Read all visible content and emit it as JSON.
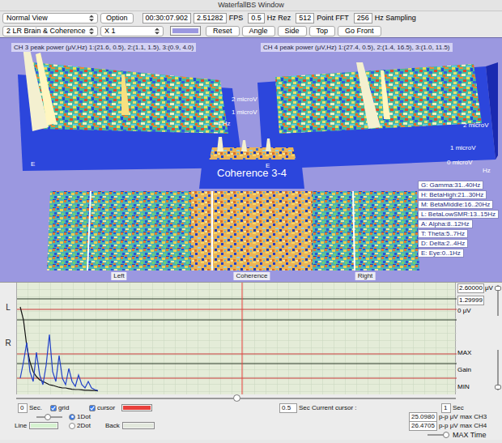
{
  "window": {
    "title": "WaterfallBS Window"
  },
  "toolbar": {
    "view_mode": {
      "value": "Normal View"
    },
    "option_button": "Option",
    "time": "00:30:07.902",
    "fps": {
      "value": "2.51282",
      "unit": "FPS"
    },
    "resolution": {
      "value": "0.5",
      "unit": "Hz Rez"
    },
    "fft": {
      "value": "512",
      "unit": "Point FFT"
    },
    "sampling": {
      "value": "256",
      "unit": "Hz Sampling"
    },
    "layout": {
      "value": "2 LR Brain & Coherence"
    },
    "zoom": {
      "value": "X 1"
    },
    "background_swatch": {
      "color": "#9b98e0"
    },
    "buttons": [
      "Reset",
      "Angle",
      "Side",
      "Top",
      "Go Front"
    ]
  },
  "view3d": {
    "ch3_label": "CH 3 peak power (μV,Hz) 1:(21.6, 0.5), 2:(1.1, 1.5), 3:(0.9, 4.0)",
    "ch4_label": "CH 4 peak power (μV,Hz) 1:(27.4, 0.5), 2:(1.4, 16.5), 3:(1.0, 11.5)",
    "coherence_label": "Coherence 3-4",
    "axis_labels": [
      "2 microV",
      "1 microV",
      "4 Hz",
      "E",
      "2 microV",
      "1 microV",
      "0 microV",
      "Hz",
      "E"
    ],
    "panel_labels": [
      "Left",
      "Coherence",
      "Right"
    ],
    "legend": [
      "G: Gamma:31..40Hz",
      "H: BetaHigh:21..30Hz",
      "M: BetaMiddle:16..20Hz",
      "L: BetaLowSMR:13..15Hz",
      "A: Alpha:8..12Hz",
      "T: Theta:5..7Hz",
      "D: Delta:2..4Hz",
      "E: Eye:0..1Hz"
    ]
  },
  "trace": {
    "labels": {
      "left": "L",
      "right": "R"
    },
    "scale": {
      "top": "2.60000",
      "unit": "μV",
      "mid": "1.29999",
      "zero": "0 μV",
      "level": 0.9
    },
    "series": [
      {
        "color": "#111111",
        "values": [
          2.6,
          2.2,
          1.4,
          0.9,
          0.6,
          0.45,
          0.35,
          0.3,
          0.25,
          0.2,
          0.18,
          0.15,
          0.12,
          0.1,
          0.1,
          0.08,
          0.06,
          0.05,
          0.05,
          0.04,
          0.03,
          0.03,
          0.02,
          0.02,
          0.01
        ]
      },
      {
        "color": "#2040c8",
        "values": [
          0.4,
          0.9,
          1.5,
          0.6,
          0.3,
          1.2,
          0.5,
          0.2,
          0.8,
          1.75,
          0.6,
          0.3,
          1.1,
          0.4,
          0.2,
          0.7,
          0.3,
          0.15,
          0.5,
          0.2,
          0.1,
          0.3,
          0.1,
          0.05,
          0.02
        ]
      }
    ],
    "cursor_slider": {
      "level": 0.5
    },
    "gain": {
      "max": "MAX",
      "label": "Gain",
      "min": "MIN",
      "level": 0.08
    }
  },
  "controls": {
    "start": {
      "value": "0",
      "unit": "Sec."
    },
    "grid": {
      "label": "grid",
      "checked": true
    },
    "cursor": {
      "label": "cursor",
      "checked": true,
      "color": "#e8403c"
    },
    "current_cursor": {
      "value": "0.5",
      "label": "Sec Current cursor :"
    },
    "span": {
      "value": "1",
      "unit": "Sec"
    },
    "zoom_slider": {
      "level": 0.45
    },
    "dot_modes": [
      {
        "label": "1Dot",
        "selected": true
      },
      {
        "label": "2Dot",
        "selected": false
      }
    ],
    "line_color": {
      "label": "Line",
      "color": "#d6f2d0"
    },
    "back_color": {
      "label": "Back",
      "color": "#e2e8dc"
    },
    "ch3_max": {
      "value": "25.0980",
      "label": "p-p μV max CH3"
    },
    "ch4_max": {
      "value": "26.4705",
      "label": "p-p μV max CH4"
    },
    "max_time": {
      "label": "MAX Time",
      "level": 0.9
    }
  }
}
